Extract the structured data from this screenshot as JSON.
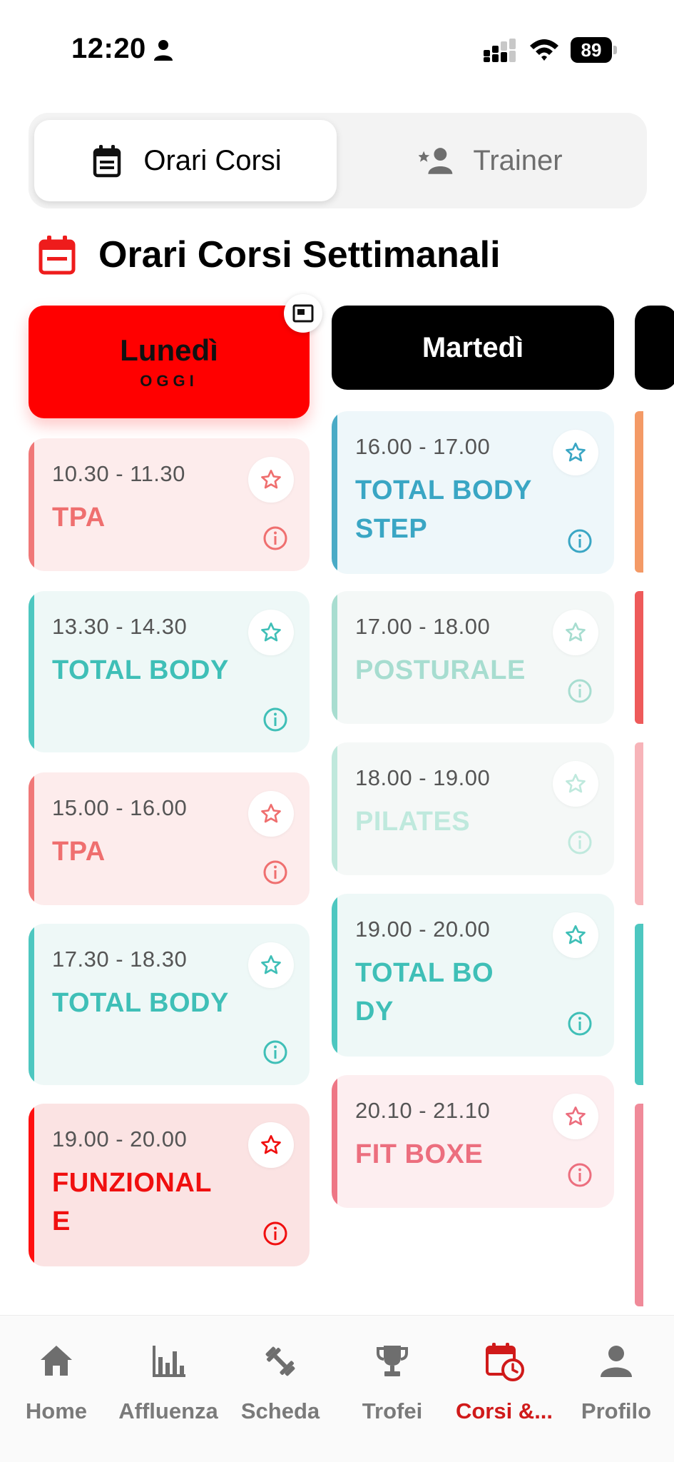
{
  "status_bar": {
    "time": "12:20",
    "battery": "89"
  },
  "tabs": [
    {
      "label": "Orari Corsi",
      "icon": "schedule-icon",
      "active": true
    },
    {
      "label": "Trainer",
      "icon": "trainer-icon",
      "active": false
    }
  ],
  "section": {
    "title": "Orari Corsi Settimanali",
    "icon": "calendar-icon"
  },
  "days": [
    {
      "name": "Lunedì",
      "today_label": "OGGI",
      "active": true
    },
    {
      "name": "Martedì",
      "active": false
    }
  ],
  "colors": {
    "accent": "#ff0000",
    "nav_active": "#d01a1a",
    "teal": "#4dc7c0",
    "pink": "#f07878"
  },
  "courses": {
    "monday": [
      {
        "time": "10.30 - 11.30",
        "name": "TPA"
      },
      {
        "time": "13.30 - 14.30",
        "name": "TOTAL BODY"
      },
      {
        "time": "15.00 - 16.00",
        "name": "TPA"
      },
      {
        "time": "17.30 - 18.30",
        "name": "TOTAL BODY"
      },
      {
        "time": "19.00 - 20.00",
        "name": "FUNZIONALE"
      }
    ],
    "tuesday": [
      {
        "time": "16.00 - 17.00",
        "name": "TOTAL BODY STEP"
      },
      {
        "time": "17.00 - 18.00",
        "name": "POSTURALE"
      },
      {
        "time": "18.00 - 19.00",
        "name": "PILATES"
      },
      {
        "time": "19.00 - 20.00",
        "name": "TOTAL BODY"
      },
      {
        "time": "20.10 - 21.10",
        "name": "FIT BOXE"
      }
    ]
  },
  "nav": [
    {
      "label": "Home",
      "icon": "home-icon"
    },
    {
      "label": "Affluenza",
      "icon": "bar-chart-icon"
    },
    {
      "label": "Scheda",
      "icon": "dumbbell-icon"
    },
    {
      "label": "Trofei",
      "icon": "trophy-icon"
    },
    {
      "label": "Corsi &...",
      "icon": "calendar-clock-icon",
      "active": true
    },
    {
      "label": "Profilo",
      "icon": "person-icon"
    }
  ]
}
